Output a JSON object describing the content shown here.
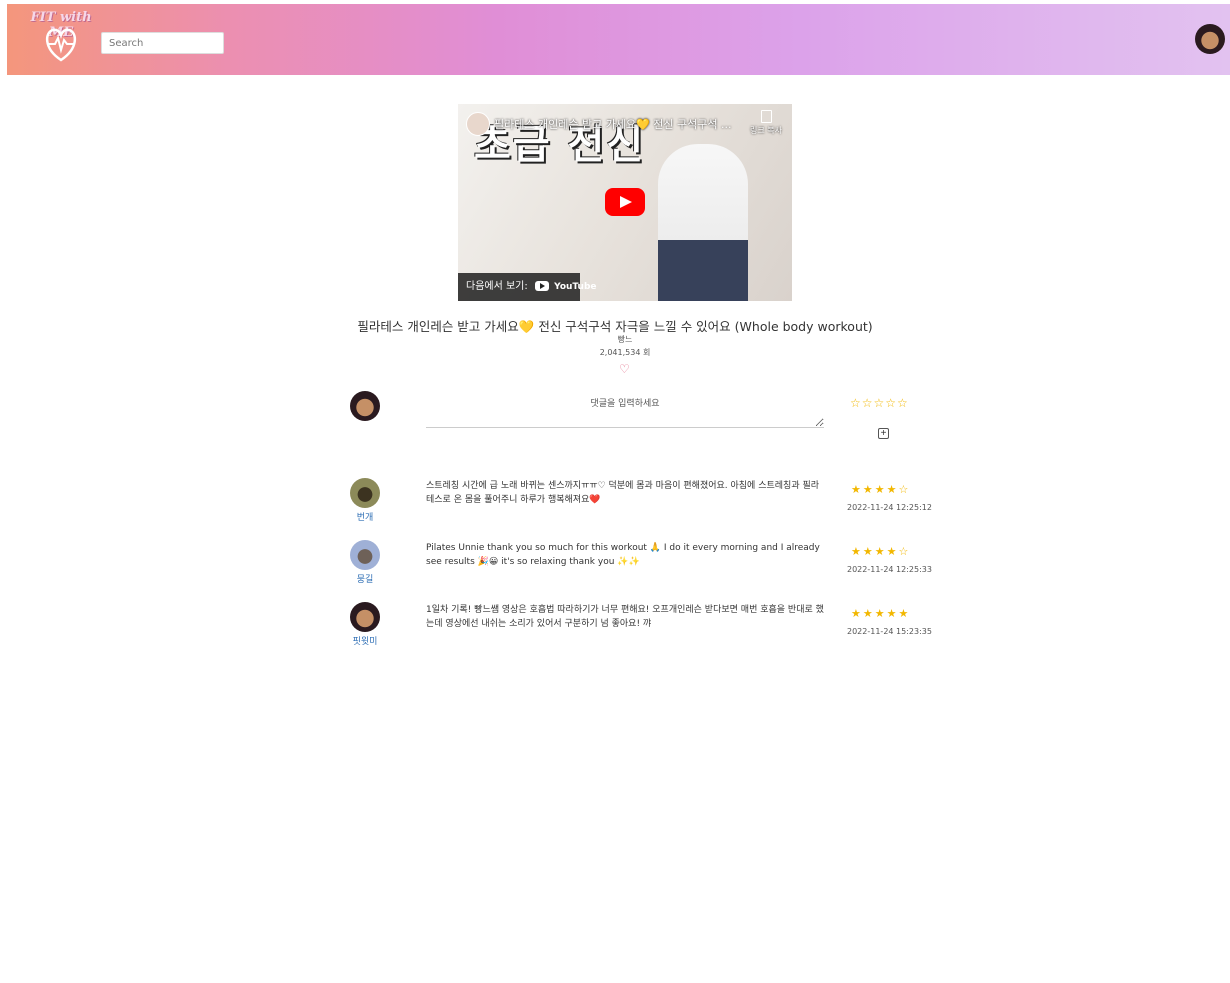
{
  "header": {
    "logo_text": "FIT with ME",
    "search_placeholder": "Search"
  },
  "video": {
    "overlay_title": "필라테스 개인레슨 받고 가세요💛 전신 구석구석 ...",
    "thumbnail_text": "초급 전신",
    "copy_link_label": "링크 복사",
    "watch_on_label": "다음에서 보기:",
    "youtube_label": "YouTube"
  },
  "title": "필라테스 개인레슨 받고 가세요💛 전신 구석구석 자극을 느낄 수 있어요 (Whole body workout)",
  "channel": "빵느",
  "views": "2,041,534 회",
  "like_icon": "heart-outline",
  "comment_input": {
    "placeholder": "댓글을 입력하세요",
    "rating_stars": "☆☆☆☆☆",
    "add_button": "+"
  },
  "comments": [
    {
      "name": "번개",
      "text": "스트레칭 시간에 급 노래 바뀌는 센스까지ㅠㅠ♡ 덕분에 몸과 마음이 편해졌어요. 아침에 스트레칭과 필라테스로 온 몸을 풀어주니 하루가 행복해져요❤️",
      "rating": 4,
      "stars": "★★★★☆",
      "date": "2022-11-24 12:25:12"
    },
    {
      "name": "뭉길",
      "text": "Pilates Unnie thank you so much for this workout 🙏 I do it every morning and I already see results 🎉😀 it's so relaxing thank you ✨✨",
      "rating": 4,
      "stars": "★★★★☆",
      "date": "2022-11-24 12:25:33"
    },
    {
      "name": "핏윗미",
      "text": "1일차 기록! 빵느쌤 영상은 호흡법 따라하기가 너무 편해요! 오프개인레슨 받다보면 매번 호흡을 반대로 했는데 영상에선 내쉬는 소리가 있어서 구분하기 넘 좋아요! 꺄",
      "rating": 5,
      "stars": "★★★★★",
      "date": "2022-11-24 15:23:35"
    }
  ]
}
